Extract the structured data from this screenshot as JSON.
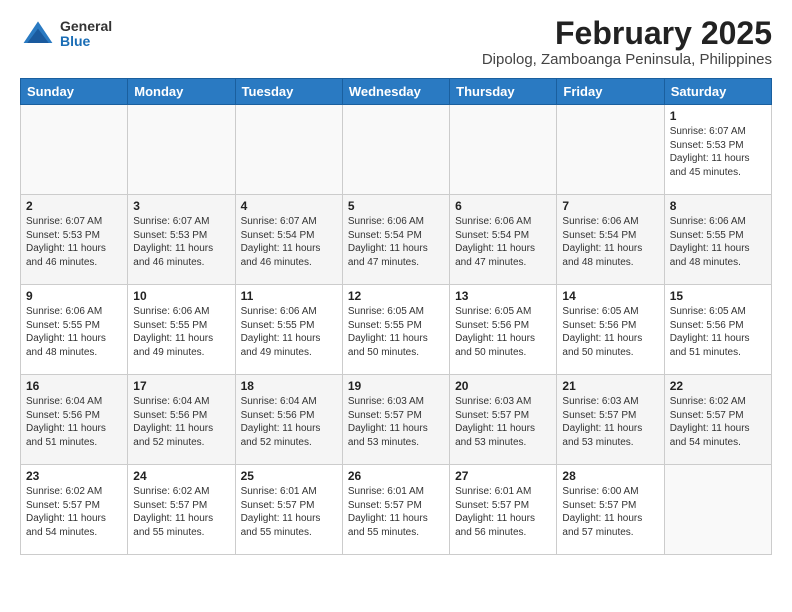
{
  "header": {
    "logo_general": "General",
    "logo_blue": "Blue",
    "title": "February 2025",
    "subtitle": "Dipolog, Zamboanga Peninsula, Philippines"
  },
  "days_of_week": [
    "Sunday",
    "Monday",
    "Tuesday",
    "Wednesday",
    "Thursday",
    "Friday",
    "Saturday"
  ],
  "weeks": [
    [
      {
        "day": "",
        "info": ""
      },
      {
        "day": "",
        "info": ""
      },
      {
        "day": "",
        "info": ""
      },
      {
        "day": "",
        "info": ""
      },
      {
        "day": "",
        "info": ""
      },
      {
        "day": "",
        "info": ""
      },
      {
        "day": "1",
        "info": "Sunrise: 6:07 AM\nSunset: 5:53 PM\nDaylight: 11 hours\nand 45 minutes."
      }
    ],
    [
      {
        "day": "2",
        "info": "Sunrise: 6:07 AM\nSunset: 5:53 PM\nDaylight: 11 hours\nand 46 minutes."
      },
      {
        "day": "3",
        "info": "Sunrise: 6:07 AM\nSunset: 5:53 PM\nDaylight: 11 hours\nand 46 minutes."
      },
      {
        "day": "4",
        "info": "Sunrise: 6:07 AM\nSunset: 5:54 PM\nDaylight: 11 hours\nand 46 minutes."
      },
      {
        "day": "5",
        "info": "Sunrise: 6:06 AM\nSunset: 5:54 PM\nDaylight: 11 hours\nand 47 minutes."
      },
      {
        "day": "6",
        "info": "Sunrise: 6:06 AM\nSunset: 5:54 PM\nDaylight: 11 hours\nand 47 minutes."
      },
      {
        "day": "7",
        "info": "Sunrise: 6:06 AM\nSunset: 5:54 PM\nDaylight: 11 hours\nand 48 minutes."
      },
      {
        "day": "8",
        "info": "Sunrise: 6:06 AM\nSunset: 5:55 PM\nDaylight: 11 hours\nand 48 minutes."
      }
    ],
    [
      {
        "day": "9",
        "info": "Sunrise: 6:06 AM\nSunset: 5:55 PM\nDaylight: 11 hours\nand 48 minutes."
      },
      {
        "day": "10",
        "info": "Sunrise: 6:06 AM\nSunset: 5:55 PM\nDaylight: 11 hours\nand 49 minutes."
      },
      {
        "day": "11",
        "info": "Sunrise: 6:06 AM\nSunset: 5:55 PM\nDaylight: 11 hours\nand 49 minutes."
      },
      {
        "day": "12",
        "info": "Sunrise: 6:05 AM\nSunset: 5:55 PM\nDaylight: 11 hours\nand 50 minutes."
      },
      {
        "day": "13",
        "info": "Sunrise: 6:05 AM\nSunset: 5:56 PM\nDaylight: 11 hours\nand 50 minutes."
      },
      {
        "day": "14",
        "info": "Sunrise: 6:05 AM\nSunset: 5:56 PM\nDaylight: 11 hours\nand 50 minutes."
      },
      {
        "day": "15",
        "info": "Sunrise: 6:05 AM\nSunset: 5:56 PM\nDaylight: 11 hours\nand 51 minutes."
      }
    ],
    [
      {
        "day": "16",
        "info": "Sunrise: 6:04 AM\nSunset: 5:56 PM\nDaylight: 11 hours\nand 51 minutes."
      },
      {
        "day": "17",
        "info": "Sunrise: 6:04 AM\nSunset: 5:56 PM\nDaylight: 11 hours\nand 52 minutes."
      },
      {
        "day": "18",
        "info": "Sunrise: 6:04 AM\nSunset: 5:56 PM\nDaylight: 11 hours\nand 52 minutes."
      },
      {
        "day": "19",
        "info": "Sunrise: 6:03 AM\nSunset: 5:57 PM\nDaylight: 11 hours\nand 53 minutes."
      },
      {
        "day": "20",
        "info": "Sunrise: 6:03 AM\nSunset: 5:57 PM\nDaylight: 11 hours\nand 53 minutes."
      },
      {
        "day": "21",
        "info": "Sunrise: 6:03 AM\nSunset: 5:57 PM\nDaylight: 11 hours\nand 53 minutes."
      },
      {
        "day": "22",
        "info": "Sunrise: 6:02 AM\nSunset: 5:57 PM\nDaylight: 11 hours\nand 54 minutes."
      }
    ],
    [
      {
        "day": "23",
        "info": "Sunrise: 6:02 AM\nSunset: 5:57 PM\nDaylight: 11 hours\nand 54 minutes."
      },
      {
        "day": "24",
        "info": "Sunrise: 6:02 AM\nSunset: 5:57 PM\nDaylight: 11 hours\nand 55 minutes."
      },
      {
        "day": "25",
        "info": "Sunrise: 6:01 AM\nSunset: 5:57 PM\nDaylight: 11 hours\nand 55 minutes."
      },
      {
        "day": "26",
        "info": "Sunrise: 6:01 AM\nSunset: 5:57 PM\nDaylight: 11 hours\nand 55 minutes."
      },
      {
        "day": "27",
        "info": "Sunrise: 6:01 AM\nSunset: 5:57 PM\nDaylight: 11 hours\nand 56 minutes."
      },
      {
        "day": "28",
        "info": "Sunrise: 6:00 AM\nSunset: 5:57 PM\nDaylight: 11 hours\nand 57 minutes."
      },
      {
        "day": "",
        "info": ""
      }
    ]
  ]
}
